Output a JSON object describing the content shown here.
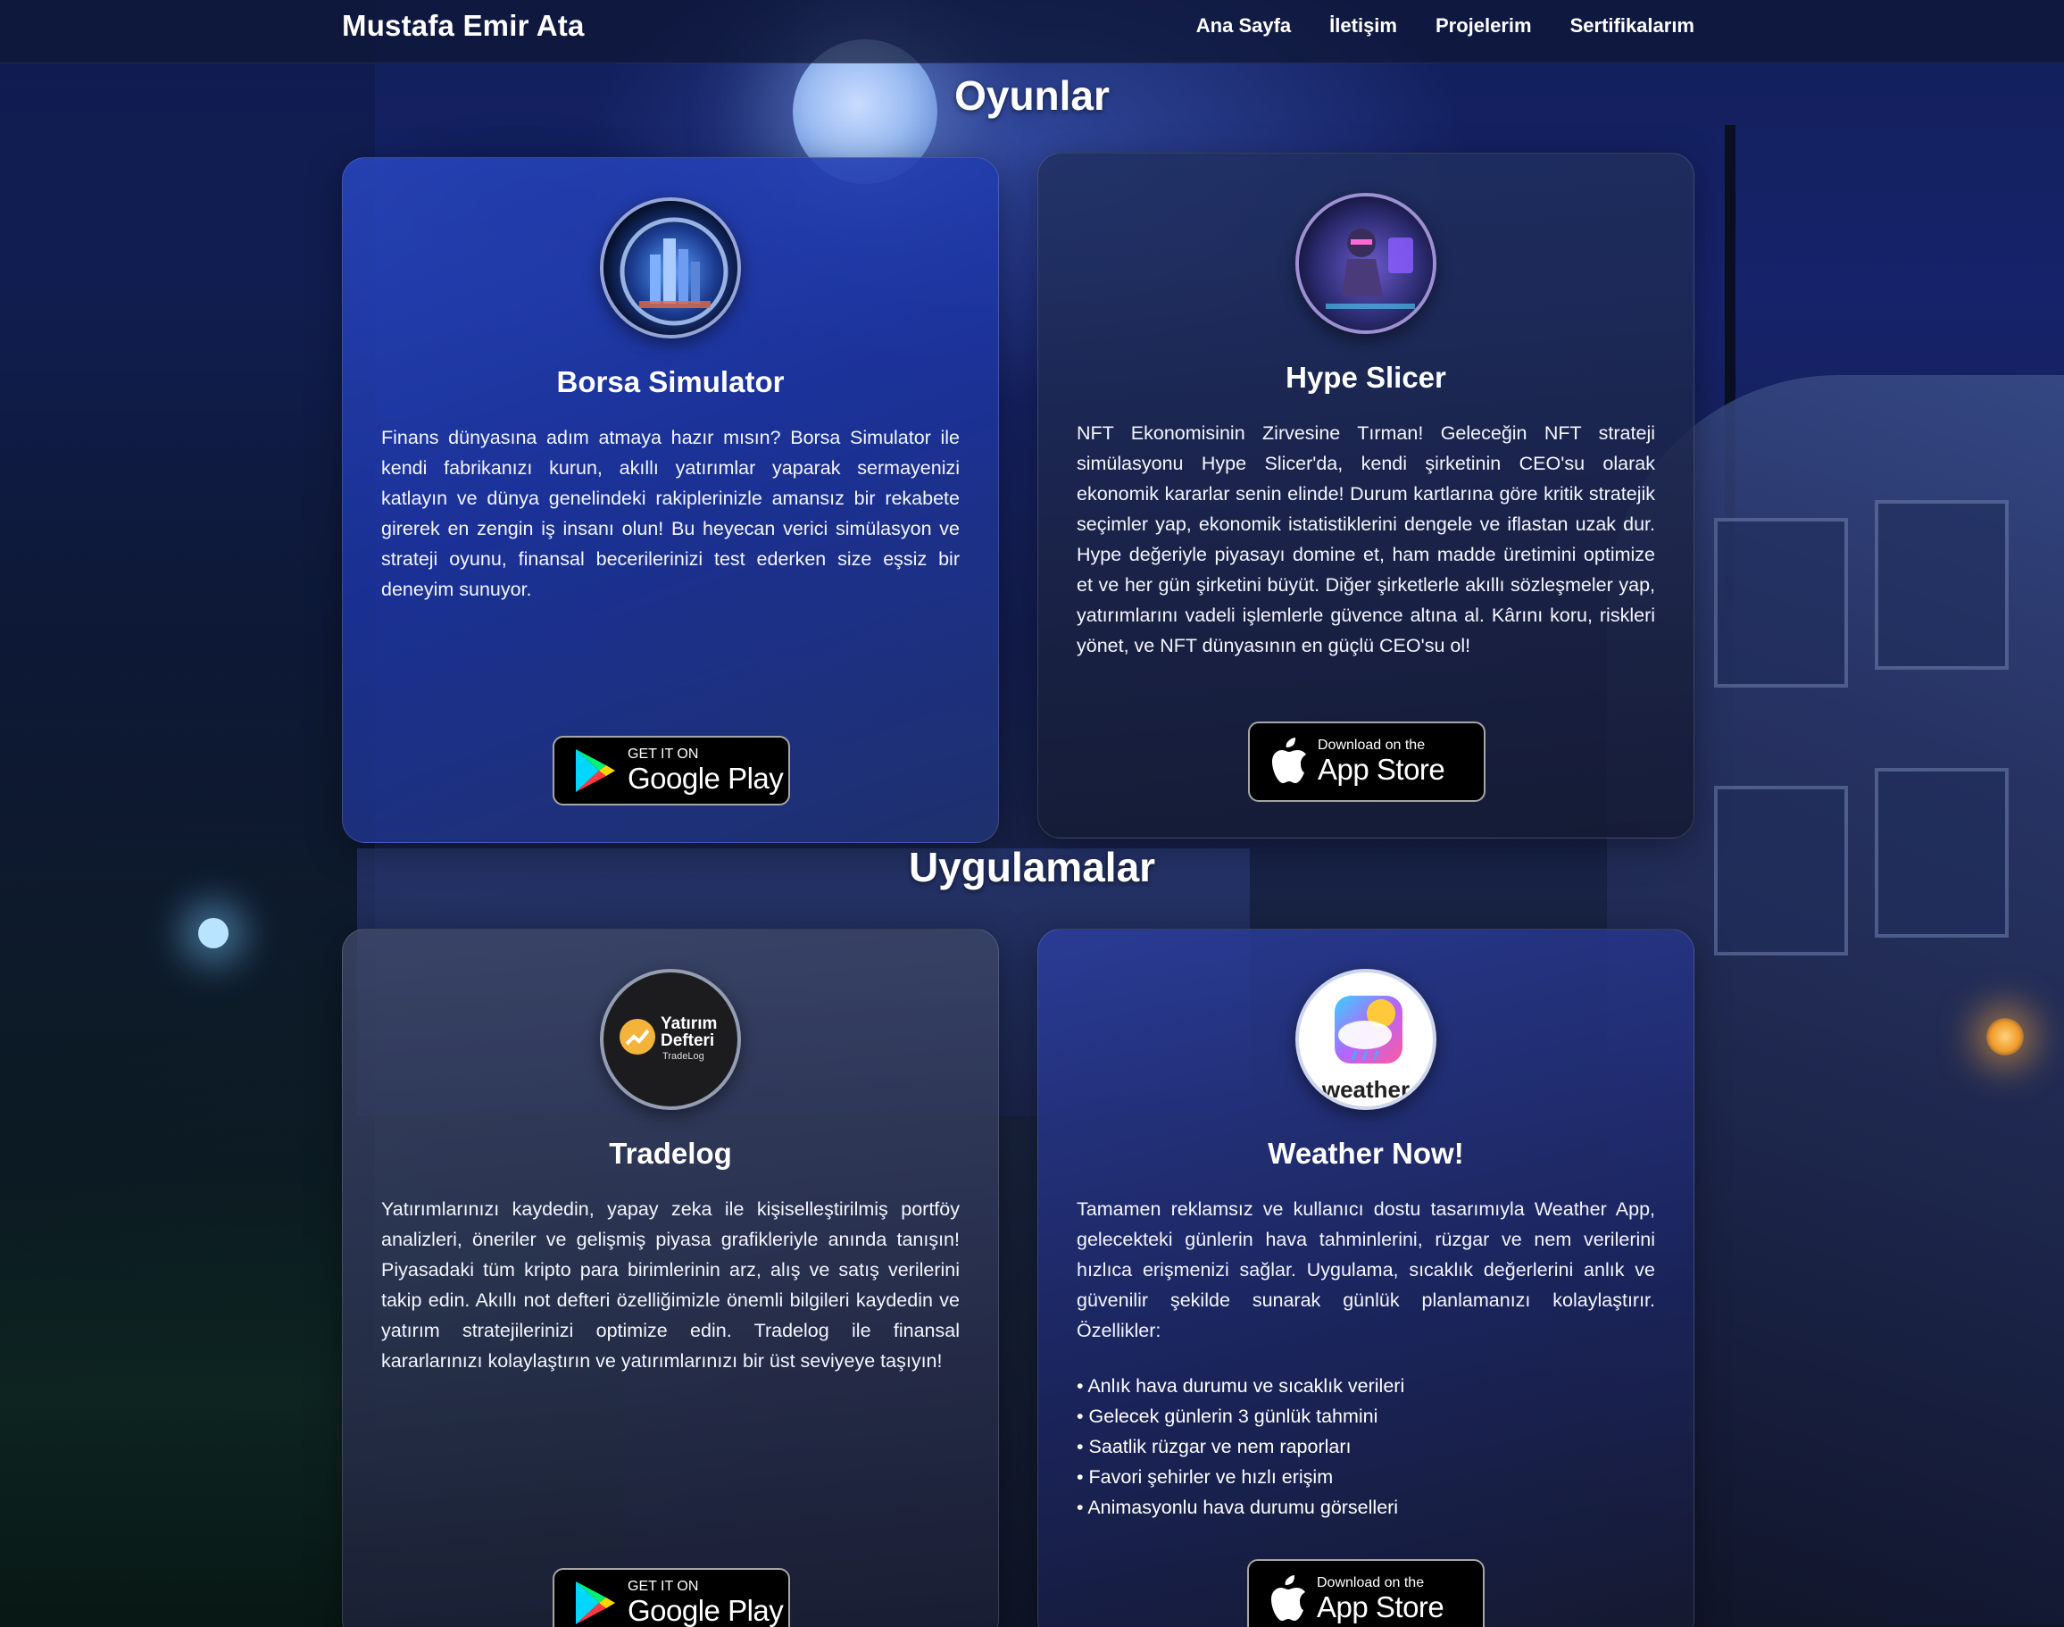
{
  "navbar": {
    "brand": "Mustafa Emir Ata",
    "links": [
      "Ana Sayfa",
      "İletişim",
      "Projelerim",
      "Sertifikalarım"
    ]
  },
  "sections": {
    "games_title": "Oyunlar",
    "apps_title": "Uygulamalar"
  },
  "cards": [
    {
      "title": "Borsa Simulator",
      "description": "Finans dünyasına adım atmaya hazır mısın? Borsa Simulator ile kendi fabrikanızı kurun, akıllı yatırımlar yaparak sermayenizi katlayın ve dünya genelindeki rakiplerinizle amansız bir rekabete girerek en zengin iş insanı olun! Bu heyecan verici simülasyon ve strateji oyunu, finansal becerilerinizi test ederken size eşsiz bir deneyim sunuyor.",
      "store": {
        "small": "GET IT ON",
        "big": "Google Play"
      }
    },
    {
      "title": "Hype Slicer",
      "description": "NFT Ekonomisinin Zirvesine Tırman! Geleceğin NFT strateji simülasyonu Hype Slicer'da, kendi şirketinin CEO'su olarak ekonomik kararlar senin elinde! Durum kartlarına göre kritik stratejik seçimler yap, ekonomik istatistiklerini dengele ve iflastan uzak dur. Hype değeriyle piyasayı domine et, ham madde üretimini optimize et ve her gün şirketini büyüt. Diğer şirketlerle akıllı sözleşmeler yap, yatırımlarını vadeli işlemlerle güvence altına al. Kârını koru, riskleri yönet, ve NFT dünyasının en güçlü CEO'su ol!",
      "store": {
        "small": "Download on the",
        "big": "App Store"
      }
    },
    {
      "title": "Tradelog",
      "logo_text": {
        "line1": "Yatırım",
        "line2": "Defteri",
        "line3": "TradeLog"
      },
      "description": "Yatırımlarınızı kaydedin, yapay zeka ile kişiselleştirilmiş portföy analizleri, öneriler ve gelişmiş piyasa grafikleriyle anında tanışın! Piyasadaki tüm kripto para birimlerinin arz, alış ve satış verilerini takip edin. Akıllı not defteri özelliğimizle önemli bilgileri kaydedin ve yatırım stratejilerinizi optimize edin. Tradelog ile finansal kararlarınızı kolaylaştırın ve yatırımlarınızı bir üst seviyeye taşıyın!",
      "store": {
        "small": "GET IT ON",
        "big": "Google Play"
      }
    },
    {
      "title": "Weather Now!",
      "logo_text": "weather",
      "description": "Tamamen reklamsız ve kullanıcı dostu tasarımıyla Weather App, gelecekteki günlerin hava tahminlerini, rüzgar ve nem verilerini hızlıca erişmenizi sağlar. Uygulama, sıcaklık değerlerini anlık ve güvenilir şekilde sunarak günlük planlamanızı kolaylaştırır. Özellikler:",
      "features": [
        "Anlık hava durumu ve sıcaklık verileri",
        "Gelecek günlerin 3 günlük tahmini",
        "Saatlik rüzgar ve nem raporları",
        "Favori şehirler ve hızlı erişim",
        "Animasyonlu hava durumu görselleri"
      ],
      "store": {
        "small": "Download on the",
        "big": "App Store"
      }
    }
  ],
  "colors": {
    "card_blue": "#2846be",
    "card_slate": "#203060",
    "nav_bg": "#0e1634",
    "badge_bg": "#000000"
  },
  "icons": [
    "google-play-icon",
    "apple-icon"
  ]
}
